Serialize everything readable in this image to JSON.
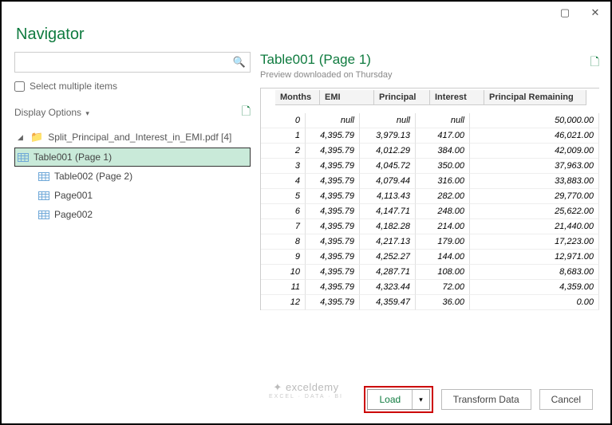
{
  "window": {
    "title": "Navigator"
  },
  "left": {
    "search_placeholder": "",
    "select_multiple": "Select multiple items",
    "display_options": "Display Options",
    "root_label": "Split_Principal_and_Interest_in_EMI.pdf [4]",
    "items": [
      {
        "label": "Table001 (Page 1)",
        "selected": true,
        "type": "table"
      },
      {
        "label": "Table002 (Page 2)",
        "selected": false,
        "type": "table"
      },
      {
        "label": "Page001",
        "selected": false,
        "type": "table"
      },
      {
        "label": "Page002",
        "selected": false,
        "type": "table"
      }
    ]
  },
  "preview": {
    "title": "Table001 (Page 1)",
    "subtitle": "Preview downloaded on Thursday",
    "columns": [
      "Months",
      "EMI",
      "Principal",
      "Interest",
      "Principal Remaining"
    ]
  },
  "buttons": {
    "load": "Load",
    "transform": "Transform Data",
    "cancel": "Cancel"
  },
  "watermark": {
    "main": "exceldemy",
    "sub": "EXCEL · DATA · BI"
  },
  "chart_data": {
    "type": "table",
    "columns": [
      "Months",
      "EMI",
      "Principal",
      "Interest",
      "Principal Remaining"
    ],
    "rows": [
      [
        "0",
        "null",
        "null",
        "null",
        "50,000.00"
      ],
      [
        "1",
        "4,395.79",
        "3,979.13",
        "417.00",
        "46,021.00"
      ],
      [
        "2",
        "4,395.79",
        "4,012.29",
        "384.00",
        "42,009.00"
      ],
      [
        "3",
        "4,395.79",
        "4,045.72",
        "350.00",
        "37,963.00"
      ],
      [
        "4",
        "4,395.79",
        "4,079.44",
        "316.00",
        "33,883.00"
      ],
      [
        "5",
        "4,395.79",
        "4,113.43",
        "282.00",
        "29,770.00"
      ],
      [
        "6",
        "4,395.79",
        "4,147.71",
        "248.00",
        "25,622.00"
      ],
      [
        "7",
        "4,395.79",
        "4,182.28",
        "214.00",
        "21,440.00"
      ],
      [
        "8",
        "4,395.79",
        "4,217.13",
        "179.00",
        "17,223.00"
      ],
      [
        "9",
        "4,395.79",
        "4,252.27",
        "144.00",
        "12,971.00"
      ],
      [
        "10",
        "4,395.79",
        "4,287.71",
        "108.00",
        "8,683.00"
      ],
      [
        "11",
        "4,395.79",
        "4,323.44",
        "72.00",
        "4,359.00"
      ],
      [
        "12",
        "4,395.79",
        "4,359.47",
        "36.00",
        "0.00"
      ]
    ]
  }
}
